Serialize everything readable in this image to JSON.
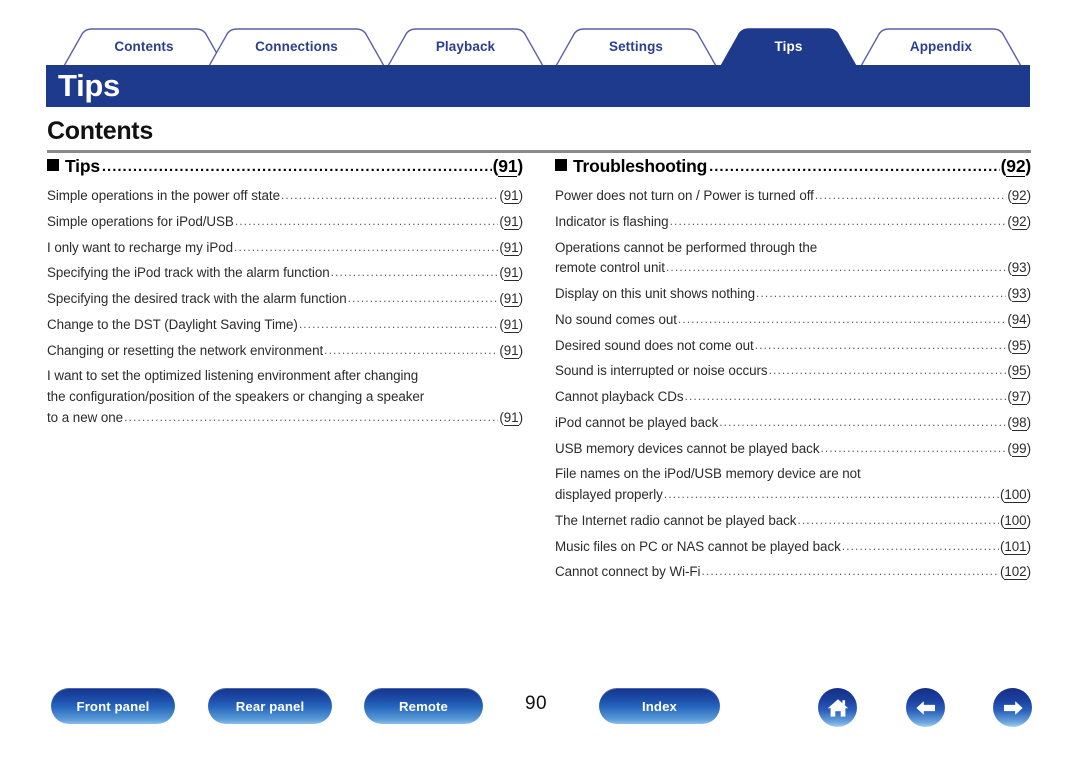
{
  "theme": {
    "brand_navy": "#1e3a8c",
    "tab_text_blue": "#2b3f8f",
    "rule_gray": "#8a8a8a",
    "body_text": "#2b2b2b"
  },
  "tabs": [
    {
      "label": "Contents",
      "active": false
    },
    {
      "label": "Connections",
      "active": false
    },
    {
      "label": "Playback",
      "active": false
    },
    {
      "label": "Settings",
      "active": false
    },
    {
      "label": "Tips",
      "active": true
    },
    {
      "label": "Appendix",
      "active": false
    }
  ],
  "header": {
    "page_title": "Tips"
  },
  "contents": {
    "heading": "Contents"
  },
  "columns": {
    "left": {
      "section": {
        "title": "Tips",
        "page": "91"
      },
      "items": [
        {
          "lines": [
            "Simple operations in the power off state"
          ],
          "page": "91"
        },
        {
          "lines": [
            "Simple operations for iPod/USB"
          ],
          "page": "91"
        },
        {
          "lines": [
            "I only want to recharge my iPod"
          ],
          "page": "91"
        },
        {
          "lines": [
            "Specifying the iPod track with the alarm function"
          ],
          "page": "91"
        },
        {
          "lines": [
            "Specifying the desired track with the alarm function"
          ],
          "page": "91"
        },
        {
          "lines": [
            "Change to the DST (Daylight Saving Time)"
          ],
          "page": "91"
        },
        {
          "lines": [
            "Changing or resetting the network environment"
          ],
          "page": "91"
        },
        {
          "lines": [
            "I want to set the optimized listening environment after changing",
            "the configuration/position of the speakers or changing a speaker",
            "to a new one"
          ],
          "page": "91"
        }
      ]
    },
    "right": {
      "section": {
        "title": "Troubleshooting",
        "page": "92"
      },
      "items": [
        {
          "lines": [
            "Power does not turn on / Power is turned off"
          ],
          "page": "92"
        },
        {
          "lines": [
            "Indicator is flashing"
          ],
          "page": "92"
        },
        {
          "lines": [
            "Operations cannot be performed through the",
            "remote control unit"
          ],
          "page": "93"
        },
        {
          "lines": [
            "Display on this unit shows nothing"
          ],
          "page": "93"
        },
        {
          "lines": [
            "No sound comes out"
          ],
          "page": "94"
        },
        {
          "lines": [
            "Desired sound does not come out"
          ],
          "page": "95"
        },
        {
          "lines": [
            "Sound is interrupted or noise occurs"
          ],
          "page": "95"
        },
        {
          "lines": [
            "Cannot playback CDs"
          ],
          "page": "97"
        },
        {
          "lines": [
            "iPod cannot be played back"
          ],
          "page": "98"
        },
        {
          "lines": [
            "USB memory devices cannot be played back"
          ],
          "page": "99"
        },
        {
          "lines": [
            "File names on the iPod/USB memory device are not",
            "displayed properly"
          ],
          "page": "100"
        },
        {
          "lines": [
            "The Internet radio cannot be played back"
          ],
          "page": "100"
        },
        {
          "lines": [
            "Music files on PC or NAS cannot be played back"
          ],
          "page": "101"
        },
        {
          "lines": [
            "Cannot connect by Wi-Fi"
          ],
          "page": "102"
        }
      ]
    }
  },
  "footer": {
    "buttons": [
      {
        "label": "Front panel"
      },
      {
        "label": "Rear panel"
      },
      {
        "label": "Remote"
      },
      {
        "label": "Index"
      }
    ],
    "page_number": "90",
    "icons": [
      {
        "name": "home-icon"
      },
      {
        "name": "arrow-left-icon"
      },
      {
        "name": "arrow-right-icon"
      }
    ]
  }
}
